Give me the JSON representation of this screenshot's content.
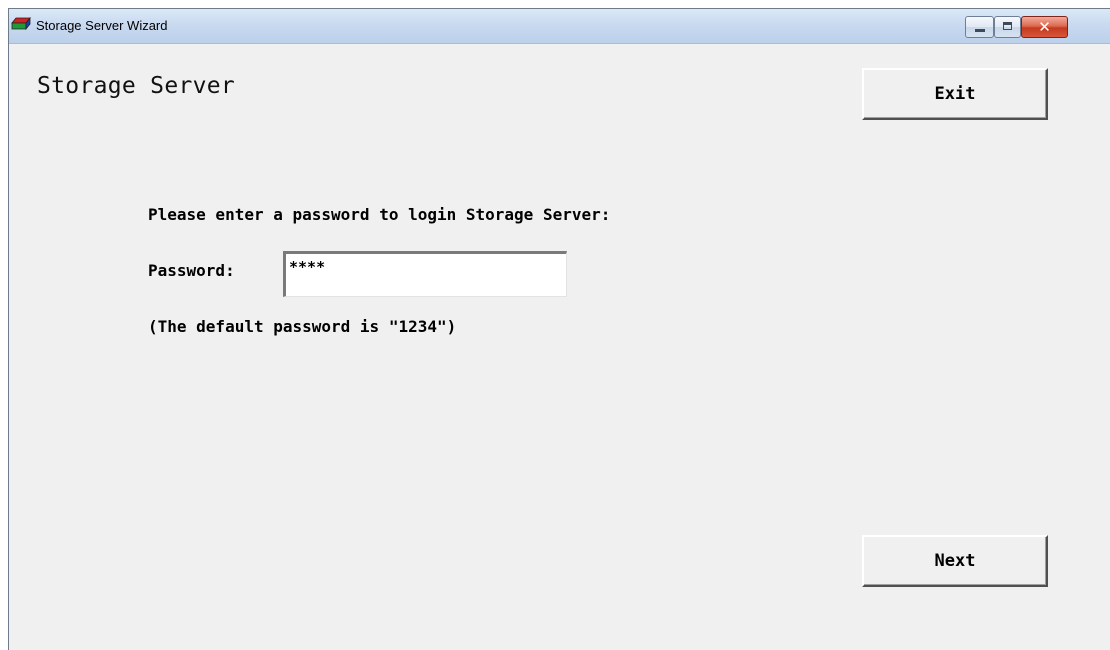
{
  "window": {
    "title": "Storage Server Wizard",
    "icon": "storage-device-icon"
  },
  "title_buttons": {
    "minimize": "minimize-icon",
    "maximize": "maximize-icon",
    "close_glyph": "✕"
  },
  "main": {
    "heading": "Storage Server",
    "prompt": "Please enter a password to login Storage Server:",
    "password_label": "Password:",
    "password_value": "****",
    "hint": "(The default password is \"1234\")"
  },
  "buttons": {
    "exit_label": "Exit",
    "next_label": "Next"
  },
  "colors": {
    "window_bg": "#f0f0f0",
    "titlebar": "#c9daf0",
    "close_button": "#c43a1f"
  }
}
